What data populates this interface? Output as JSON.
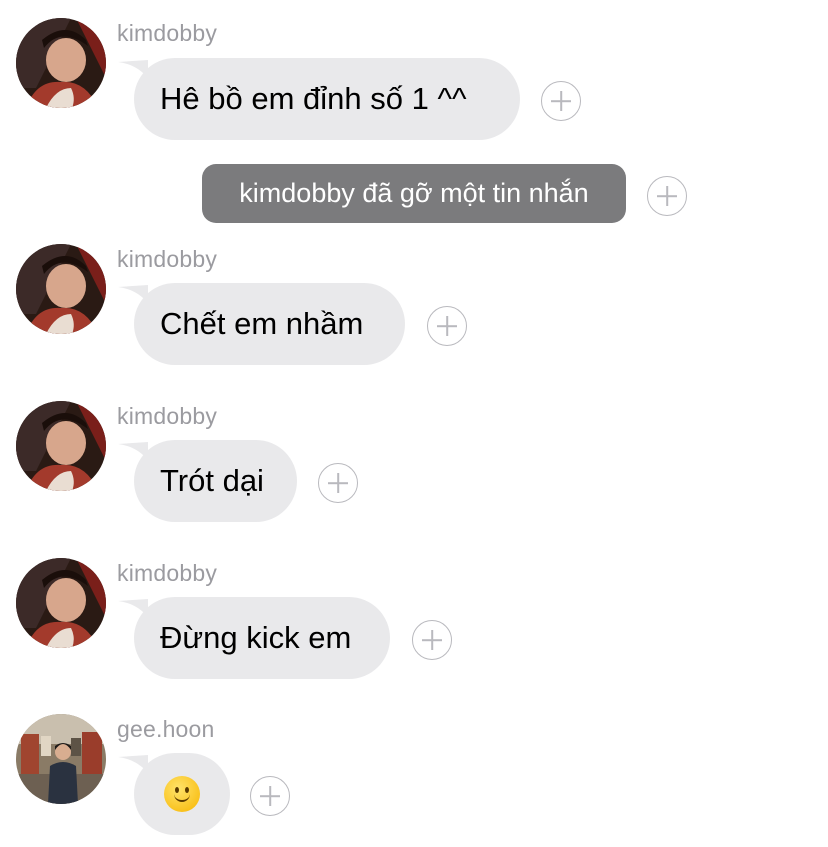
{
  "messages": [
    {
      "sender": "kimdobby",
      "text": "Hê bồ em đỉnh số 1 ^^",
      "avatar": "kimdobby-avatar"
    },
    {
      "sender": "kimdobby",
      "text": "Chết em nhầm",
      "avatar": "kimdobby-avatar"
    },
    {
      "sender": "kimdobby",
      "text": "Trót dại",
      "avatar": "kimdobby-avatar"
    },
    {
      "sender": "kimdobby",
      "text": "Đừng kick em",
      "avatar": "kimdobby-avatar"
    },
    {
      "sender": "gee.hoon",
      "text": "🙂",
      "avatar": "geehoon-avatar",
      "emoji": "slightly-smiling-face"
    }
  ],
  "system_message": "kimdobby đã gỡ một tin nhắn",
  "colors": {
    "bubble": "#e9e9eb",
    "system_bubble": "#7b7b7d",
    "sender_name": "#9b9ba0",
    "react_icon": "#b9b9be"
  }
}
